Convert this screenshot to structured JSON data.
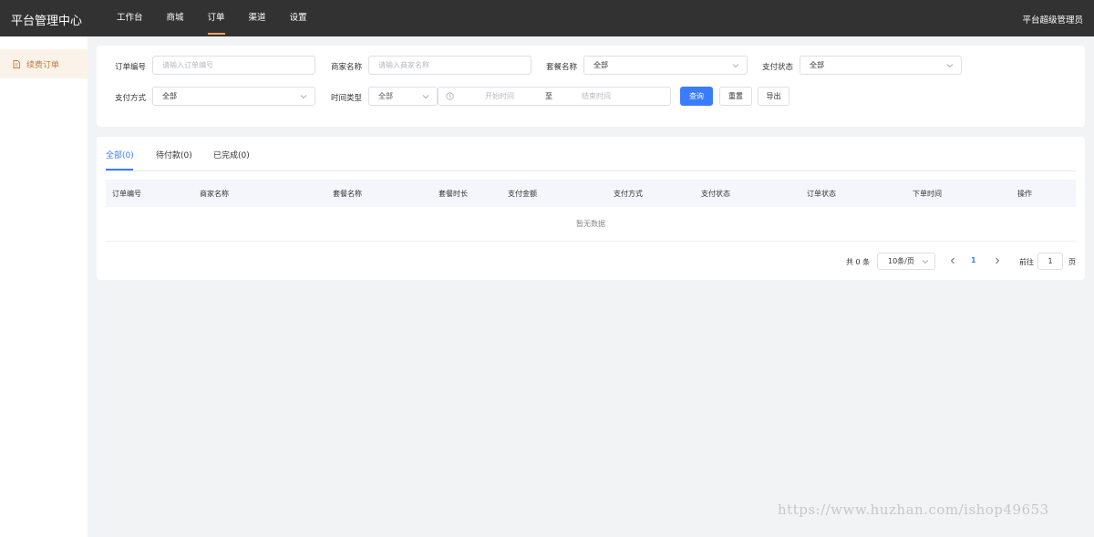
{
  "header": {
    "brand": "平台管理中心",
    "nav": [
      "工作台",
      "商城",
      "订单",
      "渠道",
      "设置"
    ],
    "active_nav": "订单",
    "admin": "平台超级管理员"
  },
  "sidebar": {
    "items": [
      {
        "label": "续费订单",
        "icon": "document-icon"
      }
    ]
  },
  "filters": {
    "order_no": {
      "label": "订单编号",
      "placeholder": "请输入订单编号"
    },
    "merchant": {
      "label": "商家名称",
      "placeholder": "请输入商家名称"
    },
    "package": {
      "label": "套餐名称",
      "value": "全部"
    },
    "pay_status": {
      "label": "支付状态",
      "value": "全部"
    },
    "pay_method": {
      "label": "支付方式",
      "value": "全部"
    },
    "time_type": {
      "label": "时间类型",
      "value": "全部"
    },
    "date_range": {
      "start": "开始时间",
      "sep": "至",
      "end": "结束时间"
    },
    "buttons": {
      "search": "查询",
      "reset": "重置",
      "export": "导出"
    }
  },
  "tabs": [
    "全部(0)",
    "待付款(0)",
    "已完成(0)"
  ],
  "table": {
    "columns": [
      "订单编号",
      "商家名称",
      "套餐名称",
      "套餐时长",
      "支付金额",
      "支付方式",
      "支付状态",
      "订单状态",
      "下单时间",
      "操作"
    ],
    "empty": "暂无数据"
  },
  "pagination": {
    "total": "共 0 条",
    "page_size": "10条/页",
    "current": "1",
    "goto_label": "前往",
    "goto_value": "1",
    "page_unit": "页"
  },
  "watermark": "https://www.huzhan.com/ishop49653",
  "colors": {
    "accent": "#3b7cff",
    "nav_active": "#f0a35e",
    "sidebar_active": "#c67b3d",
    "topbar": "#323232"
  }
}
